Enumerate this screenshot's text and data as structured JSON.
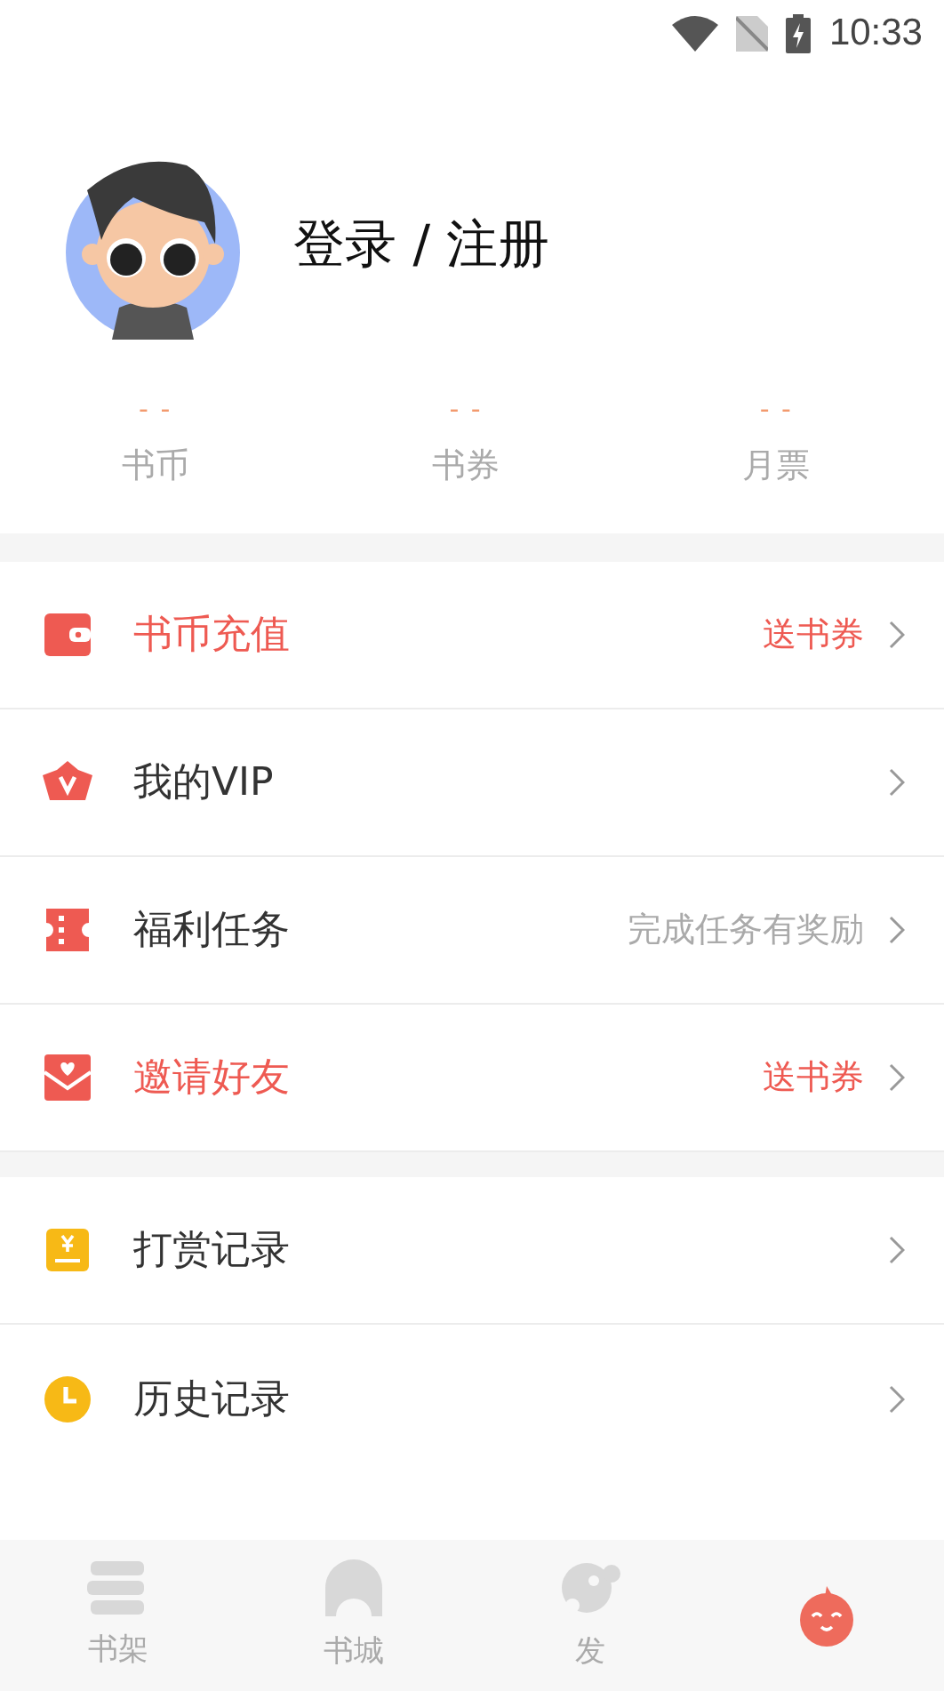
{
  "status_bar": {
    "time": "10:33"
  },
  "profile": {
    "title": "登录 / 注册"
  },
  "stats": [
    {
      "value": "- -",
      "label": "书币"
    },
    {
      "value": "- -",
      "label": "书券"
    },
    {
      "value": "- -",
      "label": "月票"
    }
  ],
  "sections": [
    {
      "items": [
        {
          "label": "书币充值",
          "detail": "送书券",
          "highlight": true
        },
        {
          "label": "我的VIP",
          "highlight": false
        },
        {
          "label": "福利任务",
          "detail": "完成任务有奖励",
          "highlight": false
        },
        {
          "label": "邀请好友",
          "detail": "送书券",
          "highlight": true
        }
      ]
    },
    {
      "items": [
        {
          "label": "打赏记录",
          "highlight": false
        },
        {
          "label": "历史记录",
          "highlight": false
        }
      ]
    }
  ],
  "tabs": [
    {
      "label": "书架",
      "selected": false
    },
    {
      "label": "书城",
      "selected": false
    },
    {
      "label": "发",
      "selected": false
    },
    {
      "selected": true
    }
  ]
}
